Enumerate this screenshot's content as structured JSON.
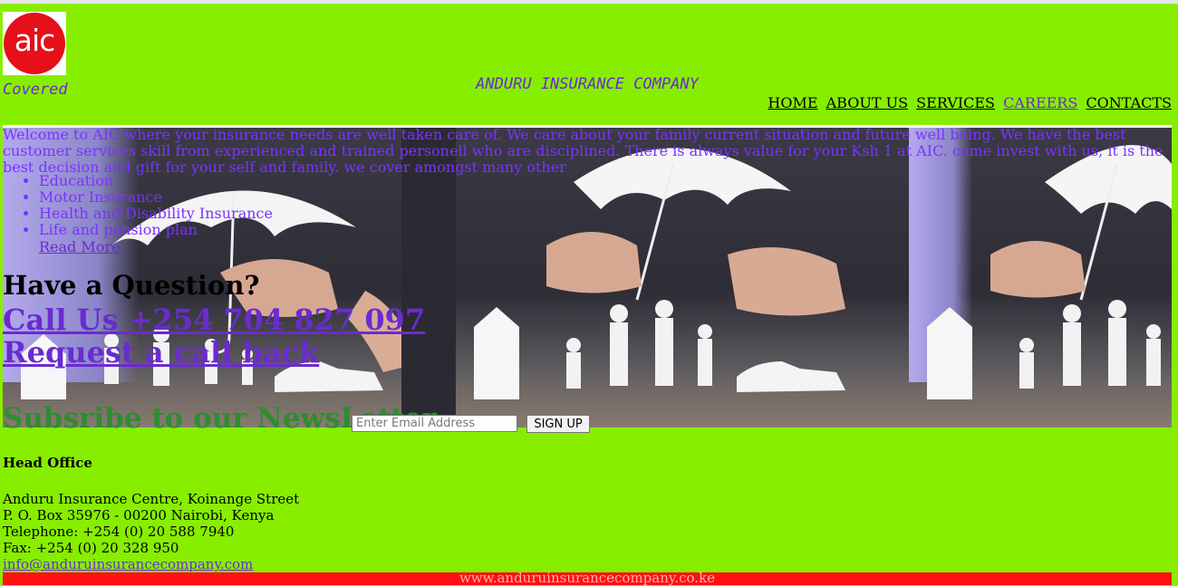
{
  "brand": {
    "logo_text": "aic",
    "tagline": "Covered",
    "company_name": "ANDURU INSURANCE COMPANY",
    "colors": {
      "background": "#88ee00",
      "logo_red": "#e5101a",
      "link_purple": "#6a2bd0",
      "footer_red": "#ff1111"
    }
  },
  "nav": {
    "items": [
      {
        "label": "HOME"
      },
      {
        "label": "ABOUT US"
      },
      {
        "label": "SERVICES"
      },
      {
        "label": "CAREERS"
      },
      {
        "label": "CONTACTS"
      }
    ]
  },
  "hero": {
    "intro": "Welcome to AIC where your insurance needs are well taken care of. We care about your family current situation and future well being. We have the best customer services skill from experienced and trained personell who are disciplined. There is always value for your Ksh 1 at AIC. come invest with us, it is the best decision and gift for your self and family. we cover amongst many other",
    "services": [
      "Education",
      "Motor Insurance",
      "Health and Disability Insurance",
      "Life and pension plan"
    ],
    "read_more": "Read More",
    "question": "Have a Question?",
    "call_us": "Call Us +254 704 827 097",
    "call_back": "Request a call back"
  },
  "newsletter": {
    "heading": "Subsribe to our NewsLetter",
    "placeholder": "Enter Email Address",
    "button": "SIGN UP"
  },
  "office": {
    "heading": "Head Office",
    "lines": [
      "Anduru Insurance Centre, Koinange Street",
      "P. O. Box 35976 - 00200 Nairobi, Kenya",
      "Telephone: +254 (0) 20 588 7940",
      "Fax: +254 (0) 20 328 950"
    ],
    "email": "info@anduruinsurancecompany.com"
  },
  "footer": {
    "website": "www.anduruinsurancecompany.co.ke"
  }
}
